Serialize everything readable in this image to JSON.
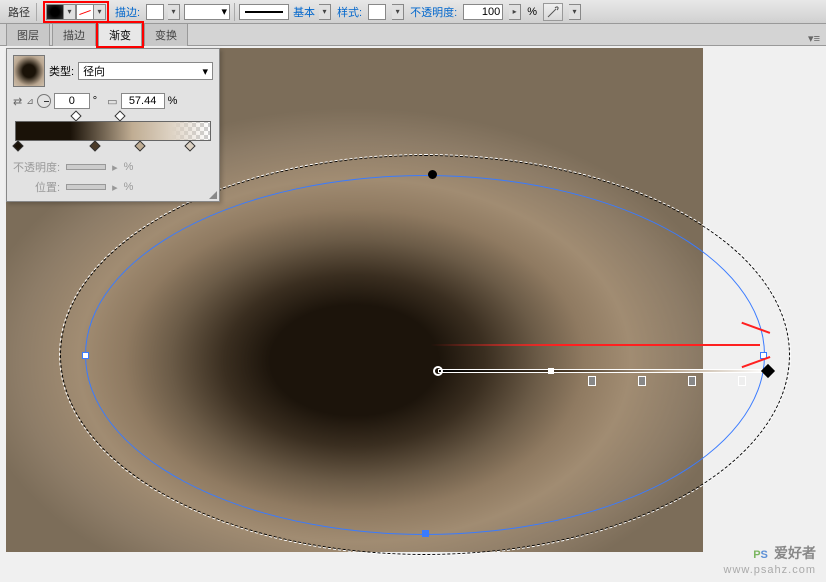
{
  "optbar": {
    "label_path": "路径",
    "label_stroke": "描边:",
    "stroke_width": "▾",
    "line_style_label": "基本",
    "style_label": "样式:",
    "opacity_label": "不透明度:",
    "opacity_value": "100",
    "opacity_suffix": "%"
  },
  "tabs": [
    "图层",
    "描边",
    "渐变",
    "变换"
  ],
  "panel": {
    "type_label": "类型:",
    "type_value": "径向",
    "angle_value": "0",
    "angle_suffix": "°",
    "scale_value": "57.44",
    "scale_suffix": "%",
    "opacity_label": "不透明度:",
    "opacity_suffix": "%",
    "position_label": "位置:",
    "position_suffix": "%",
    "stops": [
      {
        "pos": 0,
        "color": "#1a1208"
      },
      {
        "pos": 38,
        "color": "#4a3a28"
      },
      {
        "pos": 62,
        "color": "#c0ad93"
      },
      {
        "pos": 90,
        "color": "#ddd2c3"
      }
    ]
  },
  "watermark": {
    "brand_p": "P",
    "brand_s": "S",
    "brand_cn": "爱好者",
    "url": "www.psahz.com"
  },
  "chart_data": {
    "type": "other",
    "note": "Photoshop/Illustrator-like UI showing radial gradient editing on an elliptical path; gradient panel shows type=径向 (radial), angle=0°, scale=57.44%. Gradient stops approx at 0%, 38%, 62%, 90% from dark brown #1a1208 to light tan #ddd2c3."
  }
}
